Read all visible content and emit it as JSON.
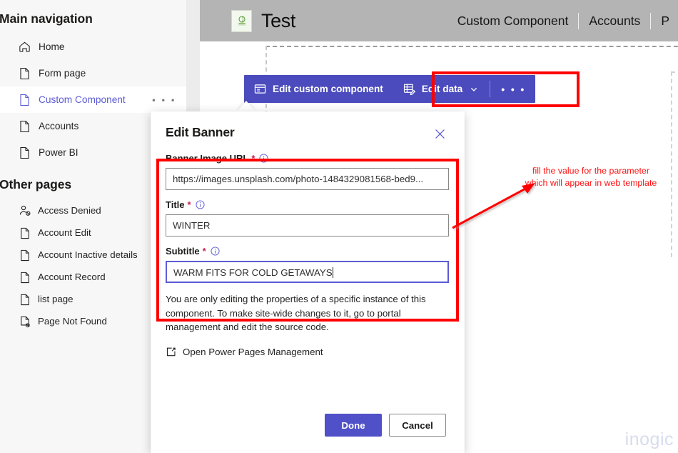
{
  "sidebar": {
    "groups": [
      {
        "title": "Main navigation",
        "items": [
          {
            "label": "Home",
            "icon": "home-icon",
            "active": false,
            "ellipsis": false
          },
          {
            "label": "Form page",
            "icon": "page-icon",
            "active": false,
            "ellipsis": false
          },
          {
            "label": "Custom Component",
            "icon": "page-icon",
            "active": true,
            "ellipsis": true
          },
          {
            "label": "Accounts",
            "icon": "page-icon",
            "active": false,
            "ellipsis": false
          },
          {
            "label": "Power BI",
            "icon": "page-icon",
            "active": false,
            "ellipsis": false
          }
        ]
      },
      {
        "title": "Other pages",
        "items": [
          {
            "label": "Access Denied",
            "icon": "person-blocked-icon",
            "active": false,
            "ellipsis": false
          },
          {
            "label": "Account Edit",
            "icon": "page-icon",
            "active": false,
            "ellipsis": false
          },
          {
            "label": "Account Inactive details",
            "icon": "page-icon",
            "active": false,
            "ellipsis": false
          },
          {
            "label": "Account Record",
            "icon": "page-icon",
            "active": false,
            "ellipsis": false
          },
          {
            "label": "list page",
            "icon": "page-icon",
            "active": false,
            "ellipsis": false
          },
          {
            "label": "Page Not Found",
            "icon": "page-blocked-icon",
            "active": false,
            "ellipsis": false
          }
        ]
      }
    ],
    "ellipsis_glyph": "• • •"
  },
  "site_header": {
    "brand_name": "Test",
    "logo_alt": "business-logo",
    "nav_items": [
      "Custom Component",
      "Accounts"
    ],
    "nav_partial": "P"
  },
  "component_toolbar": {
    "edit_component_label": "Edit custom component",
    "edit_data_label": "Edit data",
    "overflow_glyph": "• • •"
  },
  "dialog": {
    "title": "Edit Banner",
    "close_label": "Close",
    "fields": [
      {
        "label": "Banner Image URL",
        "required_marker": "*",
        "value": "https://images.unsplash.com/photo-1484329081568-bed9...",
        "placeholder": "",
        "focused": false
      },
      {
        "label": "Title",
        "required_marker": "*",
        "value": "WINTER",
        "placeholder": "",
        "focused": false
      },
      {
        "label": "Subtitle",
        "required_marker": "*",
        "value": "WARM FITS FOR COLD GETAWAYS",
        "placeholder": "",
        "focused": true
      }
    ],
    "helper_text": "You are only editing the properties of a specific instance of this component. To make site-wide changes to it, go to portal management and edit the source code.",
    "management_link": "Open Power Pages Management",
    "done_label": "Done",
    "cancel_label": "Cancel"
  },
  "annotation": {
    "line1": "fill the value for the parameter",
    "line2": "which will appear in web template",
    "color": "#ff1111"
  },
  "watermark": {
    "text": "inogic",
    "color": "#d7dced"
  },
  "colors": {
    "accent_purple": "#5050c8",
    "toolbar_purple": "#4b4bbd",
    "highlight_red": "#ff0000",
    "sidebar_bg": "#f7f7f7",
    "canvas_bg": "#ececec",
    "header_scrim": "#b4b4b4"
  }
}
